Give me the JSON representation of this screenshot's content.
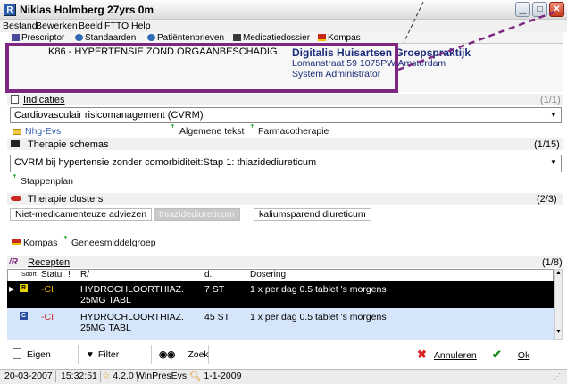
{
  "window": {
    "title": "Niklas Holmberg 27yrs 0m",
    "app_icon": "R"
  },
  "menu": [
    "Bestand",
    "Bewerken",
    "Beeld",
    "FTTO",
    "Help"
  ],
  "tabs": [
    "Prescriptor",
    "Standaarden",
    "Patiëntenbrieven",
    "Medicatiedossier",
    "Kompas"
  ],
  "header": {
    "diagnosis": "K86 - HYPERTENSIE ZOND.ORGAANBESCHADIG.",
    "practice_name": "Digitalis Huisartsen Groepspraktijk",
    "practice_address": "Lomanstraat 59 1075PW Amsterdam",
    "practice_user": "System Administrator"
  },
  "indicaties": {
    "label": "Indicaties",
    "count": "(1/1)",
    "value": "Cardiovasculair risicomanagement (CVRM)",
    "links": [
      "Nhg-Evs",
      "Algemene tekst",
      "Farmacotherapie"
    ]
  },
  "therapie_schemas": {
    "label": "Therapie schemas",
    "count": "(1/15)",
    "value": "CVRM bij hypertensie zonder comorbiditeit:Stap 1: thiazidediureticum",
    "link": "Stappenplan"
  },
  "therapie_clusters": {
    "label": "Therapie clusters",
    "count": "(2/3)",
    "tabs": [
      "Niet-medicamenteuze adviezen",
      "thiazidediureticum",
      "kaliumsparend diureticum"
    ],
    "links": [
      "Kompas",
      "Geneesmiddelgroep"
    ]
  },
  "recepten": {
    "label": "Recepten",
    "count": "(1/8)",
    "columns": [
      "Soort",
      "Statu",
      "!",
      "R/",
      "d.",
      "Dosering"
    ],
    "rows": [
      {
        "status": "-CI",
        "drug": "HYDROCHLOORTHIAZ.",
        "drug2": "25MG TABL",
        "d": "7 ST",
        "dosering": "1 x per dag 0.5 tablet 's morgens"
      },
      {
        "status": "-CI",
        "drug": "HYDROCHLOORTHIAZ.",
        "drug2": "25MG TABL",
        "d": "45 ST",
        "dosering": "1 x per dag 0.5 tablet 's morgens"
      }
    ]
  },
  "toolbar": {
    "eigen_keuze": "Eigen keuze",
    "filter": "Filter instelling",
    "zoek": "Zoek",
    "annuleren": "Annuleren",
    "ok": "Ok"
  },
  "status": {
    "date": "20-03-2007",
    "time": "15:32:51",
    "version": "4.2.0",
    "module": "WinPresEvs",
    "date2": "1-1-2009"
  },
  "colors": {
    "highlight": "#7d2682",
    "practice_text": "#1b2b7a",
    "selected_row": "#000000"
  }
}
